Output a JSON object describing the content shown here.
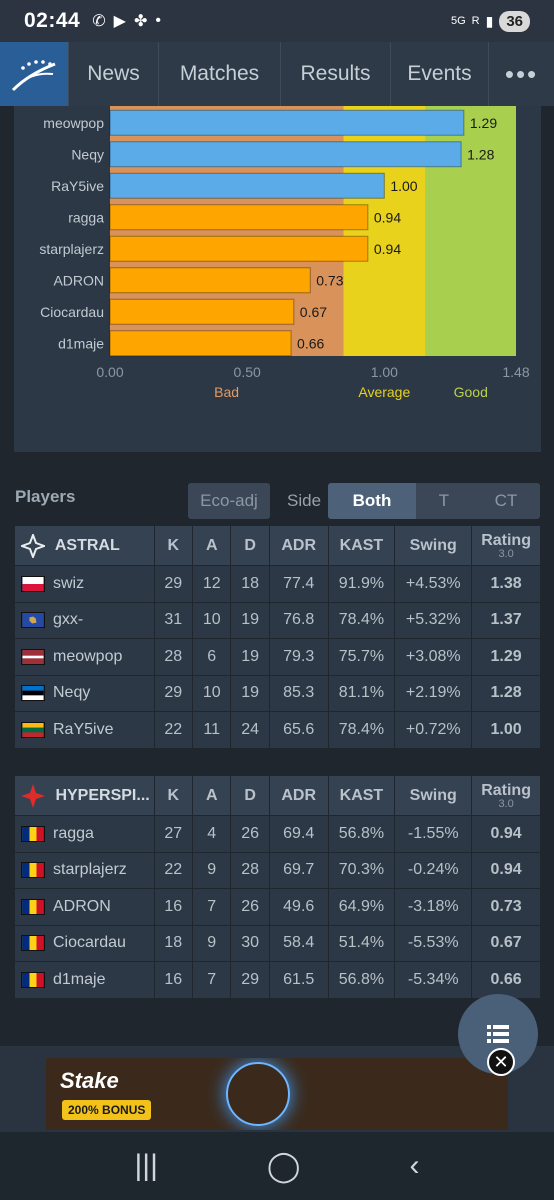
{
  "status_bar": {
    "time": "02:44",
    "network": "5G",
    "signal_label": "R",
    "battery": "36"
  },
  "nav": {
    "items": [
      "News",
      "Matches",
      "Results",
      "Events"
    ],
    "more": "•••"
  },
  "chart_data": {
    "type": "bar",
    "orientation": "horizontal",
    "categories": [
      "meowpop",
      "Neqy",
      "RaY5ive",
      "ragga",
      "starplajerz",
      "ADRON",
      "Ciocardau",
      "d1maje"
    ],
    "values": [
      1.29,
      1.28,
      1.0,
      0.94,
      0.94,
      0.73,
      0.67,
      0.66
    ],
    "value_labels": [
      "1.29",
      "1.28",
      "1.00",
      "0.94",
      "0.94",
      "0.73",
      "0.67",
      "0.66"
    ],
    "bar_colors": [
      "#5aabe8",
      "#5aabe8",
      "#5aabe8",
      "#ffa500",
      "#ffa500",
      "#ffa500",
      "#ffa500",
      "#ffa500"
    ],
    "xlim": [
      0,
      1.48
    ],
    "x_ticks": [
      "0.00",
      "0.50",
      "1.00",
      "1.48"
    ],
    "x_tick_values": [
      0,
      0.5,
      1.0,
      1.48
    ],
    "zones": [
      {
        "label": "Bad",
        "from": 0,
        "to": 0.85,
        "color": "#d9925a",
        "label_color": "#e29a60"
      },
      {
        "label": "Average",
        "from": 0.85,
        "to": 1.15,
        "color": "#e8d21c",
        "label_color": "#e8d21c"
      },
      {
        "label": "Good",
        "from": 1.15,
        "to": 1.48,
        "color": "#a9cf4e",
        "label_color": "#b8d24e"
      }
    ],
    "grid": false
  },
  "controls": {
    "players_label": "Players",
    "eco_adj": "Eco-adj",
    "side_label": "Side",
    "sides": [
      "Both",
      "T",
      "CT"
    ],
    "active_side": "Both"
  },
  "table_headers": {
    "k": "K",
    "a": "A",
    "d": "D",
    "adr": "ADR",
    "kast": "KAST",
    "swing": "Swing",
    "rating": "Rating",
    "rating_version": "3.0"
  },
  "teams": [
    {
      "name": "ASTRAL",
      "players": [
        {
          "name": "swiz",
          "flag": "pl",
          "k": "29",
          "a": "12",
          "d": "18",
          "adr": "77.4",
          "kast": "91.9%",
          "swing": "+4.53%",
          "rating": "1.38",
          "swing_class": "pos",
          "rating_class": "r-good"
        },
        {
          "name": "gxx-",
          "flag": "xk",
          "k": "31",
          "a": "10",
          "d": "19",
          "adr": "76.8",
          "kast": "78.4%",
          "swing": "+5.32%",
          "rating": "1.37",
          "swing_class": "pos",
          "rating_class": "r-good"
        },
        {
          "name": "meowpop",
          "flag": "lv",
          "k": "28",
          "a": "6",
          "d": "19",
          "adr": "79.3",
          "kast": "75.7%",
          "swing": "+3.08%",
          "rating": "1.29",
          "swing_class": "pos",
          "rating_class": "r-good"
        },
        {
          "name": "Neqy",
          "flag": "ee",
          "k": "29",
          "a": "10",
          "d": "19",
          "adr": "85.3",
          "kast": "81.1%",
          "swing": "+2.19%",
          "rating": "1.28",
          "swing_class": "pos",
          "rating_class": "r-good"
        },
        {
          "name": "RaY5ive",
          "flag": "lt",
          "k": "22",
          "a": "11",
          "d": "24",
          "adr": "65.6",
          "kast": "78.4%",
          "swing": "+0.72%",
          "rating": "1.00",
          "swing_class": "neu",
          "rating_class": "r-avg"
        }
      ]
    },
    {
      "name": "HYPERSPI...",
      "players": [
        {
          "name": "ragga",
          "flag": "ro",
          "k": "27",
          "a": "4",
          "d": "26",
          "adr": "69.4",
          "kast": "56.8%",
          "swing": "-1.55%",
          "rating": "0.94",
          "swing_class": "neg",
          "rating_class": "r-bad"
        },
        {
          "name": "starplajerz",
          "flag": "ro",
          "k": "22",
          "a": "9",
          "d": "28",
          "adr": "69.7",
          "kast": "70.3%",
          "swing": "-0.24%",
          "rating": "0.94",
          "swing_class": "neu",
          "rating_class": "r-bad"
        },
        {
          "name": "ADRON",
          "flag": "ro",
          "k": "16",
          "a": "7",
          "d": "26",
          "adr": "49.6",
          "kast": "64.9%",
          "swing": "-3.18%",
          "rating": "0.73",
          "swing_class": "neg",
          "rating_class": "r-bad"
        },
        {
          "name": "Ciocardau",
          "flag": "ro",
          "k": "18",
          "a": "9",
          "d": "30",
          "adr": "58.4",
          "kast": "51.4%",
          "swing": "-5.53%",
          "rating": "0.67",
          "swing_class": "neg",
          "rating_class": "r-bad"
        },
        {
          "name": "d1maje",
          "flag": "ro",
          "k": "16",
          "a": "7",
          "d": "29",
          "adr": "61.5",
          "kast": "56.8%",
          "swing": "-5.34%",
          "rating": "0.66",
          "swing_class": "neg",
          "rating_class": "r-bad"
        }
      ]
    }
  ],
  "ad": {
    "brand": "Stake",
    "bonus": "200% BONUS"
  },
  "icons": {
    "logo": "hltv-logo-icon",
    "fab": "list-icon",
    "close": "close-icon"
  }
}
